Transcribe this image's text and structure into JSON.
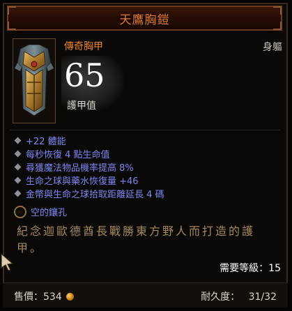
{
  "item": {
    "name": "天鷹胸鎧",
    "type": "傳奇胸甲",
    "slot": "身軀",
    "armor_value": "65",
    "armor_label": "護甲值"
  },
  "affixes": [
    "+22 體能",
    "每秒恢復 4 點生命值",
    "尋獲魔法物品機率提高 8%",
    "生命之球與藥水恢復量 +46",
    "金幣與生命之球拾取距離延長 4 碼"
  ],
  "socket": {
    "label": "空的鑲孔"
  },
  "flavor_text": "紀念迦歐德酋長戰勝東方野人而打造的護甲。",
  "requirement": "需要等級：15",
  "footer": {
    "sell_label": "售價：534",
    "durability_label": "耐久度：",
    "durability_value": "31/32"
  },
  "colors": {
    "legendary_orange": "#e8832f",
    "affix_blue": "#7e86f2",
    "flavor_gold": "#a38a5c"
  },
  "icons": [
    "chest-armor-icon",
    "socket-icon",
    "gold-coin-icon",
    "mouse-cursor-icon"
  ]
}
